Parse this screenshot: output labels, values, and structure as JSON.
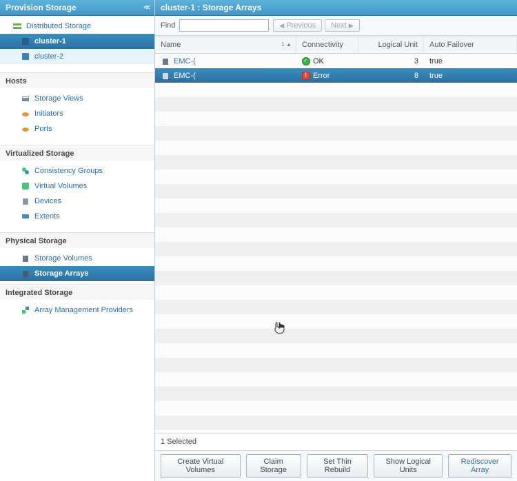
{
  "sidebar": {
    "title": "Provision Storage",
    "tree": {
      "root_label": "Distributed Storage",
      "clusters": [
        {
          "label": "cluster-1",
          "selected": true
        },
        {
          "label": "cluster-2",
          "selected": false
        }
      ]
    },
    "sections": [
      {
        "title": "Hosts",
        "items": [
          {
            "label": "Storage Views",
            "icon": "storage-views-icon"
          },
          {
            "label": "Initiators",
            "icon": "initiators-icon"
          },
          {
            "label": "Ports",
            "icon": "ports-icon"
          }
        ]
      },
      {
        "title": "Virtualized Storage",
        "items": [
          {
            "label": "Consistency Groups",
            "icon": "consistency-groups-icon"
          },
          {
            "label": "Virtual Volumes",
            "icon": "virtual-volumes-icon"
          },
          {
            "label": "Devices",
            "icon": "devices-icon"
          },
          {
            "label": "Extents",
            "icon": "extents-icon"
          }
        ]
      },
      {
        "title": "Physical Storage",
        "items": [
          {
            "label": "Storage Volumes",
            "icon": "storage-volumes-icon"
          },
          {
            "label": "Storage Arrays",
            "icon": "storage-arrays-icon",
            "selected": true
          }
        ]
      },
      {
        "title": "Integrated Storage",
        "items": [
          {
            "label": "Array Management Providers",
            "icon": "amp-icon"
          }
        ]
      }
    ]
  },
  "main": {
    "title": "cluster-1 : Storage Arrays",
    "toolbar": {
      "find_label": "Find",
      "find_value": "",
      "prev_label": "Previous",
      "next_label": "Next"
    },
    "columns": {
      "name": "Name",
      "connectivity": "Connectivity",
      "logical_unit": "Logical Unit",
      "auto_failover": "Auto Failover"
    },
    "rows": [
      {
        "name": "EMC-(",
        "connectivity": {
          "status": "ok",
          "text": "OK"
        },
        "logical_unit": "3",
        "auto_failover": "true",
        "selected": false
      },
      {
        "name": "EMC-(",
        "connectivity": {
          "status": "error",
          "text": "Error"
        },
        "logical_unit": "8",
        "auto_failover": "true",
        "selected": true
      }
    ],
    "status_text": "1 Selected",
    "actions": [
      {
        "label": "Create Virtual Volumes"
      },
      {
        "label": "Claim Storage"
      },
      {
        "label": "Set Thin Rebuild"
      },
      {
        "label": "Show Logical Units"
      },
      {
        "label": "Rediscover Array",
        "primary": true
      }
    ]
  }
}
